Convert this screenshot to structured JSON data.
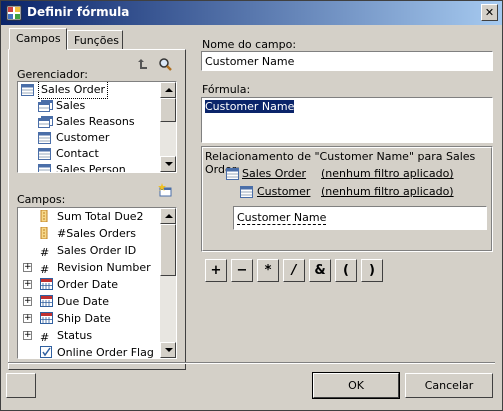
{
  "window": {
    "title": "Definir fórmula",
    "close_label": "✕"
  },
  "tabs": [
    {
      "label": "Campos",
      "active": true
    },
    {
      "label": "Funções",
      "active": false
    }
  ],
  "manager": {
    "label": "Gerenciador:",
    "items": [
      {
        "label": "Sales Order",
        "icon": "table-icon",
        "level": 0,
        "selected": true
      },
      {
        "label": "Sales",
        "icon": "multi-table-icon",
        "level": 1
      },
      {
        "label": "Sales Reasons",
        "icon": "multi-table-icon",
        "level": 1
      },
      {
        "label": "Customer",
        "icon": "table-icon",
        "level": 1
      },
      {
        "label": "Contact",
        "icon": "table-icon",
        "level": 1
      },
      {
        "label": "Sales Person",
        "icon": "table-icon",
        "level": 1
      }
    ]
  },
  "fields": {
    "label": "Campos:",
    "items": [
      {
        "label": "Sum Total Due2",
        "icon": "aggregate-icon",
        "expand": false
      },
      {
        "label": "#Sales Orders",
        "icon": "aggregate-icon",
        "expand": false
      },
      {
        "label": "Sales Order ID",
        "icon": "hash-icon",
        "expand": false
      },
      {
        "label": "Revision Number",
        "icon": "hash-icon",
        "expand": true
      },
      {
        "label": "Order Date",
        "icon": "calendar-icon",
        "expand": true
      },
      {
        "label": "Due Date",
        "icon": "calendar-icon",
        "expand": true
      },
      {
        "label": "Ship Date",
        "icon": "calendar-icon",
        "expand": true
      },
      {
        "label": "Status",
        "icon": "hash-icon",
        "expand": true
      },
      {
        "label": "Online Order Flag",
        "icon": "checkbox-field-icon",
        "expand": false
      }
    ]
  },
  "field_name": {
    "label": "Nome do campo:",
    "value": "Customer Name"
  },
  "formula": {
    "label": "Fórmula:",
    "value": "Customer Name"
  },
  "relationship": {
    "title": "Relacionamento de \"Customer Name\" para Sales Order:",
    "rows": [
      {
        "entity": "Sales Order",
        "filter": "(nenhum filtro aplicado)"
      },
      {
        "entity": "Customer",
        "filter": "(nenhum filtro aplicado)"
      }
    ],
    "field_value": "Customer Name"
  },
  "operators": [
    "+",
    "−",
    "*",
    "/",
    "&",
    "(",
    ")"
  ],
  "buttons": {
    "ok": "OK",
    "cancel": "Cancelar"
  },
  "colors": {
    "title_start": "#0a246a",
    "title_end": "#a6caf0",
    "selection": "#0a246a"
  }
}
